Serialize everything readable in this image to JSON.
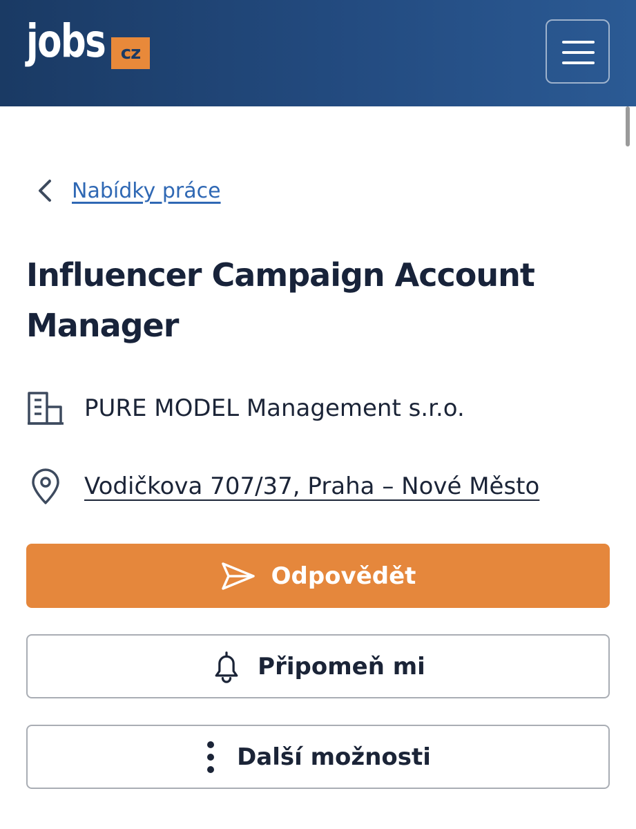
{
  "header": {
    "logo_text": "jobs",
    "logo_badge": "cz",
    "menu_icon": "hamburger-menu-icon"
  },
  "breadcrumb": {
    "icon": "chevron-left-icon",
    "label": "Nabídky práce"
  },
  "job": {
    "title": "Influencer Campaign Account Manager",
    "company": "PURE MODEL Management s.r.o.",
    "company_icon": "building-icon",
    "address": "Vodičkova 707/37, Praha – Nové Město",
    "address_icon": "location-pin-icon"
  },
  "actions": {
    "respond_label": "Odpovědět",
    "respond_icon": "send-icon",
    "remind_label": "Připomeň mi",
    "remind_icon": "bell-icon",
    "more_label": "Další možnosti",
    "more_icon": "more-vertical-icon"
  },
  "colors": {
    "header_start": "#1a3a64",
    "header_end": "#2b5a94",
    "accent_orange": "#e5873c",
    "link_blue": "#2f68b4",
    "text_dark": "#18233a"
  }
}
